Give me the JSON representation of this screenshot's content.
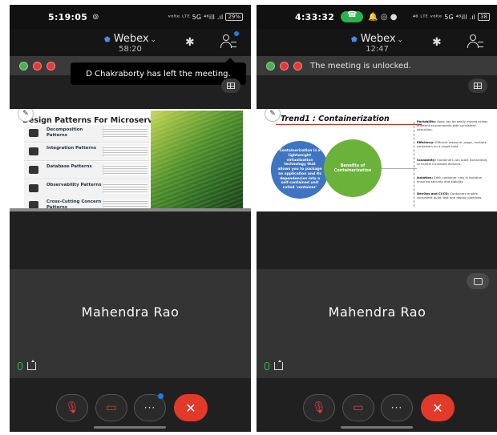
{
  "left": {
    "status": {
      "time": "5:19:05",
      "notif": "⊚",
      "sys": "ᵛᵒˡᵗᵉ ᴸᵀᴱ 5G ⁴⁶ill .ıl",
      "battery": "29%"
    },
    "app": {
      "brand": "Webex",
      "timer": "58:20"
    },
    "toast": "D Chakraborty has left the meeting.",
    "banner_message": "",
    "slide": {
      "title": "Design Patterns For Microservices",
      "rows": [
        "Decomposition Patterns",
        "Integration Patterns",
        "Database Patterns",
        "Observability Patterns",
        "Cross-Cutting Concern Patterns"
      ]
    },
    "participant": "Mahendra Rao",
    "avatar_colors": [
      "#4caf50",
      "#e53935",
      "#e53935"
    ]
  },
  "right": {
    "status": {
      "time": "4:33:32",
      "notif": "🔔 ◎ ●",
      "sys": "⁴⁶ ᴸᵀᴱ ᵛᵒˡᵗᵉ 5G ⁴⁶ill .ıl",
      "battery": "38"
    },
    "app": {
      "brand": "Webex",
      "timer": "12:47"
    },
    "banner_message": "The meeting is unlocked.",
    "slide": {
      "title": "Trend1 : Containerization",
      "blue_text": "Containerization is a lightweight virtualization technology that allows you to package an application and its dependencies into a self-contained unit called 'container'",
      "green_text": "Benefits of Containerization",
      "notes": [
        {
          "head": "Portability:",
          "body": "Apps can be easily moved across different environments with consistent execution."
        },
        {
          "head": "Efficiency:",
          "body": "Efficient resource usage, multiple containers on a single host."
        },
        {
          "head": "Scalability:",
          "body": "Containers can scale horizontally to handle increased demand."
        },
        {
          "head": "Isolation:",
          "body": "Each container runs in isolation ensuring security and stability."
        },
        {
          "head": "DevOps and CI/CD:",
          "body": "Containers enable consistent build, test and deploy pipelines."
        }
      ]
    },
    "participant": "Mahendra Rao",
    "avatar_colors": [
      "#4caf50",
      "#e53935",
      "#e53935"
    ]
  },
  "colors": {
    "accent_blue": "#1b7fe0",
    "end_call": "#e23a2a",
    "mic_green": "#3fbf5f"
  },
  "controls": {
    "more_label": "···",
    "end_label": "✕"
  }
}
